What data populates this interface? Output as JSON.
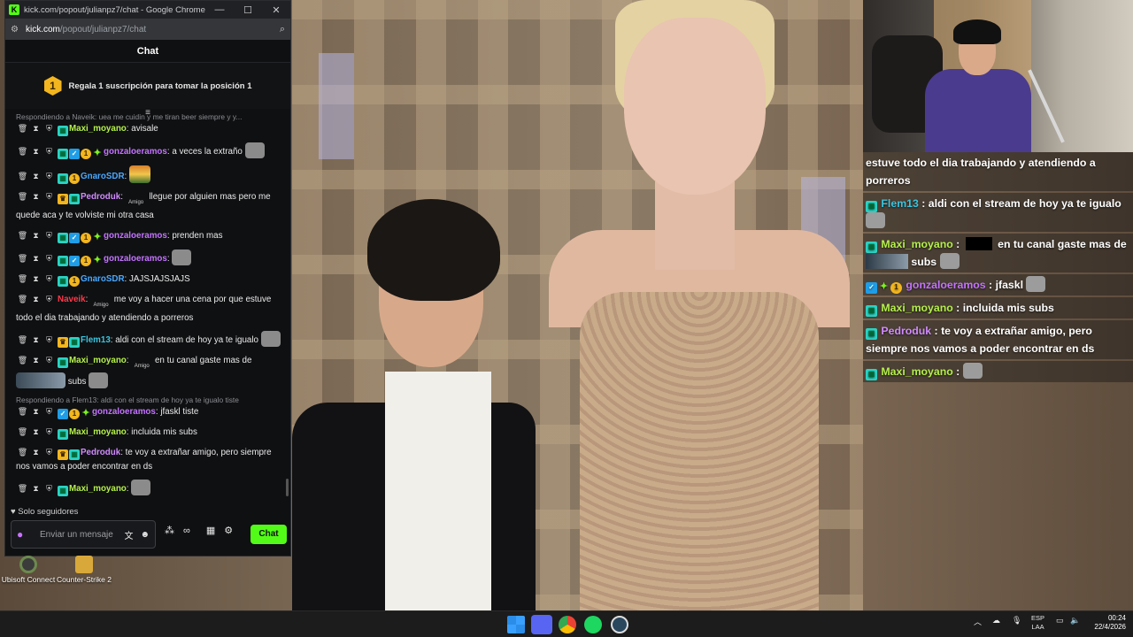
{
  "browser": {
    "window_title": "kick.com/popout/julianpz7/chat - Google Chrome",
    "url_host": "kick.com",
    "url_path": "/popout/julianpz7/chat",
    "minimize": "—",
    "maximize": "☐",
    "close": "✕"
  },
  "chat": {
    "header": "Chat",
    "gift_banner": {
      "position": "1",
      "text": "Regala 1 suscripción para tomar la posición 1"
    },
    "top_reply_context": "Respondiendo a Naveik: uea me cuidin y me tiran beer siempre y y...",
    "messages": [
      {
        "user": "Maxi_moyano",
        "user_color": "#b5f04a",
        "badges": [
          "sub"
        ],
        "text": "avisale"
      },
      {
        "user": "gonzaloeramos",
        "user_color": "#c474ff",
        "badges": [
          "sub",
          "verified",
          "gift",
          "spark"
        ],
        "text": "a veces la extraño",
        "emote_after": true
      },
      {
        "user": "GnaroSDR",
        "user_color": "#4aa8ff",
        "badges": [
          "sub",
          "gift"
        ],
        "text": "",
        "emote": "sunset"
      },
      {
        "user": "Pedroduk",
        "user_color": "#d18bff",
        "badges": [
          "crown",
          "sub"
        ],
        "amigo": "Amigo",
        "text": "llegue por alguien mas pero me quede aca y te volviste mi otra casa"
      },
      {
        "user": "gonzaloeramos",
        "user_color": "#c474ff",
        "badges": [
          "sub",
          "verified",
          "gift",
          "spark"
        ],
        "text": "prenden mas"
      },
      {
        "user": "gonzaloeramos",
        "user_color": "#c474ff",
        "badges": [
          "sub",
          "verified",
          "gift",
          "spark"
        ],
        "text": "",
        "emote": "gray"
      },
      {
        "user": "GnaroSDR",
        "user_color": "#4aa8ff",
        "badges": [
          "sub",
          "gift"
        ],
        "text": "JAJSJAJSJAJS"
      },
      {
        "user": "Naveik",
        "user_color": "#ff3a48",
        "badges": [],
        "amigo": "Amigo",
        "text": "me voy a hacer una cena por que estuve todo el dia trabajando y atendiendo a porreros"
      },
      {
        "user": "Flem13",
        "user_color": "#39c6e0",
        "badges": [
          "crown",
          "sub"
        ],
        "text": "aldi con el stream de hoy ya te igualo",
        "emote_after": true
      },
      {
        "user": "Maxi_moyano",
        "user_color": "#b5f04a",
        "badges": [
          "sub"
        ],
        "amigo": "Amigo",
        "text": "en tu canal gaste mas de",
        "pic": true,
        "tail": "subs",
        "emote_after": true
      },
      {
        "reply": "Respondiendo a Flem13: aldi con el stream de hoy ya te igualo tiste",
        "user": "gonzaloeramos",
        "user_color": "#c474ff",
        "badges": [
          "verified",
          "gift",
          "spark"
        ],
        "text": "jfaskl tiste"
      },
      {
        "user": "Maxi_moyano",
        "user_color": "#b5f04a",
        "badges": [
          "sub"
        ],
        "text": "incluida mis subs"
      },
      {
        "user": "Pedroduk",
        "user_color": "#d18bff",
        "badges": [
          "crown",
          "sub"
        ],
        "text": "te voy a extrañar amigo, pero siempre nos vamos a poder encontrar en ds"
      },
      {
        "user": "Maxi_moyano",
        "user_color": "#b5f04a",
        "badges": [
          "sub"
        ],
        "text": "",
        "emote": "gray"
      }
    ],
    "followers_only": "Solo seguidores",
    "input_placeholder": "Enviar un mensaje",
    "send_label": "Chat"
  },
  "desktop_icons": [
    {
      "label": "Ubisoft Connect"
    },
    {
      "label": "Counter-Strike 2"
    }
  ],
  "overlay": {
    "rows": [
      {
        "text": "estuve todo el dia trabajando y atendiendo a porreros"
      },
      {
        "user": "Flem13",
        "user_color": "#39c6e0",
        "text": "aldi con el stream de hoy ya te igualo"
      },
      {
        "user": "Maxi_moyano",
        "user_color": "#b5f04a",
        "text_a": "en tu canal gaste mas de",
        "text_b": "subs"
      },
      {
        "user": "gonzaloeramos",
        "user_color": "#c474ff",
        "text": "jfaskl"
      },
      {
        "user": "Maxi_moyano",
        "user_color": "#b5f04a",
        "text": "incluida mis subs"
      },
      {
        "user": "Pedroduk",
        "user_color": "#d18bff",
        "text": "te voy a extrañar amigo, pero siempre nos vamos a poder encontrar en ds"
      },
      {
        "user": "Maxi_moyano",
        "user_color": "#b5f04a",
        "text": ""
      }
    ]
  },
  "taskbar": {
    "lang_top": "ESP",
    "lang_bottom": "LAA",
    "time": "00:24",
    "date": "22/4/2026"
  },
  "colors": {
    "kick_green": "#53fc18",
    "sub_badge": "#2bd3c4",
    "gift_badge": "#f3b61f"
  }
}
